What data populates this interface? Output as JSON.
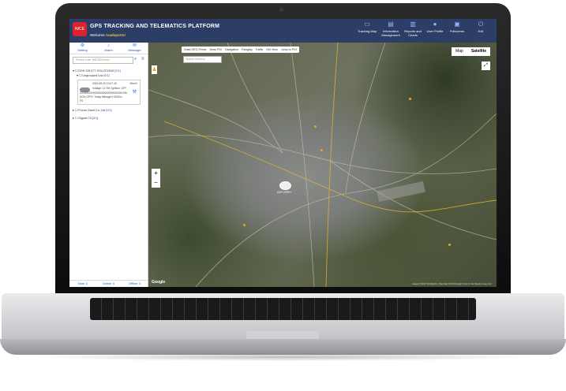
{
  "app": {
    "title": "GPS TRACKING AND TELEMATICS PLATFORM",
    "welcome_prefix": "Welcome",
    "welcome_user": "roadsports!",
    "logo_text": "NICE"
  },
  "nav": [
    {
      "label": "Tracking Map",
      "icon": "monitor-icon"
    },
    {
      "label": "Information Management",
      "icon": "document-icon"
    },
    {
      "label": "Reports and Charts",
      "icon": "chart-icon"
    },
    {
      "label": "User Profile",
      "icon": "user-icon"
    },
    {
      "label": "Fullscreen",
      "icon": "fullscreen-icon"
    },
    {
      "label": "Exit",
      "icon": "power-icon"
    }
  ],
  "sidebar": {
    "tabs": [
      {
        "label": "Setting",
        "icon": "gear-icon"
      },
      {
        "label": "Alarm",
        "icon": "bell-icon"
      },
      {
        "label": "Message",
        "icon": "envelope-icon"
      }
    ],
    "search_placeholder": "Please enter IMEI/ID/Name",
    "groups": [
      {
        "label": "DSH ON ICT SOLUTIONS",
        "count": "[0/1]"
      },
      {
        "label": "Ungrouped List",
        "count": "[0/1]"
      }
    ],
    "vehicle": {
      "time": "2019-08-20 10:07:43",
      "speed": "0Km/h",
      "line2": "Voltage: 12.78V Ignition: OFF",
      "line3": "ICHA9110000000000000000000005 09h",
      "line4": "DOH-GPS+ Today Mileage:0.000Km",
      "line5": "FS"
    },
    "more_groups": [
      {
        "label": "Focus Giant Co.,Ltd",
        "count": "[0/1]"
      },
      {
        "label": "Signal C3",
        "count": "[0/1]"
      }
    ],
    "footer": {
      "total": "Total: 3",
      "online": "Online: 0",
      "offline": "Offline: 3"
    }
  },
  "map": {
    "tools": [
      "Draw GEO-Fence",
      "Draw POI",
      "Navigation",
      "Ranging",
      "Traffic",
      "Get View",
      "Jump to POI"
    ],
    "address_placeholder": "Search Address",
    "map_type_map": "Map",
    "map_type_satellite": "Satellite",
    "zoom_in": "+",
    "zoom_out": "−",
    "google_label": "Google",
    "copyright": "Imagery ©2019 TerraMetrics, Map data ©2019 Google   Terms of Use   Report a map error",
    "vehicle_label": "DOH-GPS+"
  }
}
